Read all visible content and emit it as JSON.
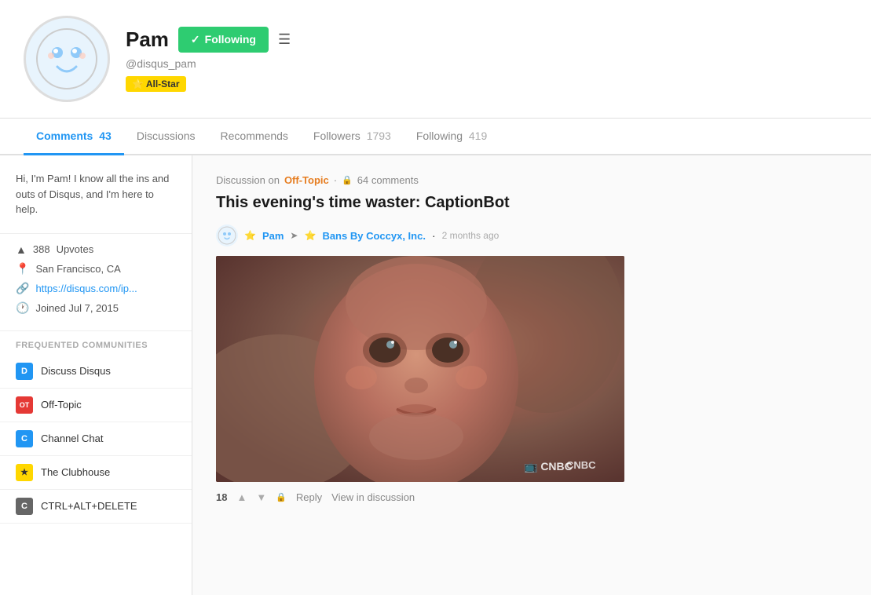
{
  "profile": {
    "name": "Pam",
    "handle": "@disqus_pam",
    "badge": "⭐ All-Star",
    "follow_button": "Following",
    "avatar_emoji": "🌐"
  },
  "tabs": [
    {
      "id": "comments",
      "label": "Comments",
      "count": "43",
      "active": true
    },
    {
      "id": "discussions",
      "label": "Discussions",
      "count": "",
      "active": false
    },
    {
      "id": "recommends",
      "label": "Recommends",
      "count": "",
      "active": false
    },
    {
      "id": "followers",
      "label": "Followers",
      "count": "1793",
      "active": false
    },
    {
      "id": "following",
      "label": "Following",
      "count": "419",
      "active": false
    }
  ],
  "sidebar": {
    "bio": "Hi, I'm Pam! I know all the ins and outs of Disqus, and I'm here to help.",
    "upvotes_count": "388",
    "upvotes_label": "Upvotes",
    "location": "San Francisco, CA",
    "link": "https://disqus.com/ip...",
    "joined": "Joined Jul 7, 2015",
    "communities_header": "Frequented Communities",
    "communities": [
      {
        "id": "discuss-disqus",
        "label": "Discuss Disqus",
        "color": "#2196f3",
        "letter": "D"
      },
      {
        "id": "off-topic",
        "label": "Off-Topic",
        "color": "#e53935",
        "letter": "OT"
      },
      {
        "id": "channel-chat",
        "label": "Channel Chat",
        "color": "#2196f3",
        "letter": "C"
      },
      {
        "id": "the-clubhouse",
        "label": "The Clubhouse",
        "color": "#ffd700",
        "letter": "★"
      },
      {
        "id": "ctrl-alt-delete",
        "label": "CTRL+ALT+DELETE",
        "color": "#666",
        "letter": "C"
      }
    ]
  },
  "discussion": {
    "prefix": "Discussion on",
    "topic": "Off-Topic",
    "separator": "·",
    "lock_icon": "🔒",
    "comment_count": "64 comments",
    "title": "This evening's time waster: CaptionBot",
    "commenter": "Pam",
    "arrow": "➤",
    "target": "Bans By Coccyx, Inc.",
    "time": "2 months ago",
    "vote_count": "18",
    "reply_label": "Reply",
    "view_label": "View in discussion",
    "cnbc": "CNBC"
  }
}
